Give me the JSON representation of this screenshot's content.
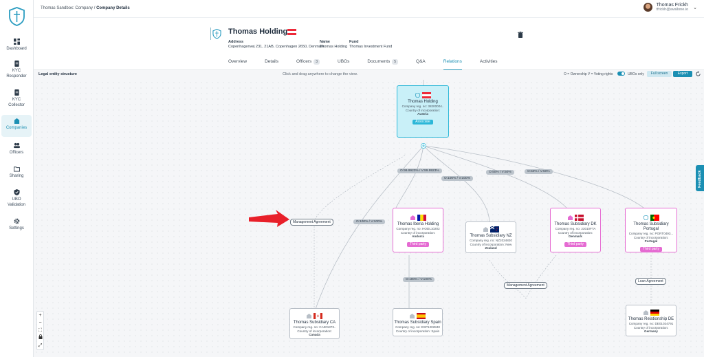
{
  "sidebar": {
    "items": [
      {
        "label": "Dashboard",
        "icon": "dashboard-icon"
      },
      {
        "label": "KYC Responder",
        "icon": "document-icon"
      },
      {
        "label": "KYC Collector",
        "icon": "document-icon"
      },
      {
        "label": "Companies",
        "icon": "buildings-icon"
      },
      {
        "label": "Officers",
        "icon": "people-icon"
      },
      {
        "label": "Sharing",
        "icon": "folder-icon"
      },
      {
        "label": "UBO Validation",
        "icon": "shield-check-icon"
      },
      {
        "label": "Settings",
        "icon": "gear-icon"
      }
    ],
    "active": "Companies"
  },
  "breadcrumb": {
    "root": "Thomas Sandbox:",
    "parent": "Company",
    "sep": "/",
    "current": "Company Details"
  },
  "user": {
    "name": "Thomas Frickh",
    "email": "tfrickh@avallone.io"
  },
  "company": {
    "name": "Thomas Holding",
    "address_label": "Address",
    "address": "Copenhagenvej 231, 21AB, Copenhagen 2650, Denmark",
    "name_label": "Name",
    "name_value": "Thomas Holding",
    "fund_label": "Fund",
    "fund_value": "Thomas Investment Fund"
  },
  "tabs": [
    {
      "label": "Overview",
      "badge": ""
    },
    {
      "label": "Details",
      "badge": ""
    },
    {
      "label": "Officers",
      "badge": "3"
    },
    {
      "label": "UBOs",
      "badge": ""
    },
    {
      "label": "Documents",
      "badge": "5"
    },
    {
      "label": "Q&A",
      "badge": ""
    },
    {
      "label": "Relations",
      "badge": ""
    },
    {
      "label": "Activities",
      "badge": ""
    }
  ],
  "toolbar": {
    "title": "Legal entity structure",
    "hint": "Click and drag anywhere to change the view.",
    "legend": "O = Ownership   V = Voting rights",
    "ubo_only": "UBOs only",
    "full_screen": "Full screen",
    "export": "Export"
  },
  "nodes": {
    "root": {
      "name": "Thomas Holding",
      "reg": "Company reg. no: 38200004..",
      "country_label": "Country of incorporation:",
      "country": "Austria",
      "tag": "Associate"
    },
    "iberia": {
      "name": "Thomas Iberia Holding",
      "reg": "Company reg. no: HODL10202",
      "country_label": "Country of incorporation:",
      "country": "Andorra",
      "tag": "Third party"
    },
    "nz": {
      "name": "Thomas Subsidiary NZ",
      "reg": "Company reg. no: NZ2024820",
      "country_label": "Country of incorporation: New",
      "country": "Zealand"
    },
    "dk": {
      "name": "Thomas Subsidiary DK",
      "reg": "Company reg. no: 23010FTA",
      "country_label": "Country of incorporation:",
      "country": "Denmark",
      "tag": "Third party"
    },
    "pt": {
      "name": "Thomas Subsidiary Portugal",
      "reg": "Company reg. no: PORT0493...",
      "country_label": "Country of incorporation:",
      "country": "Portugal",
      "tag": "Third party"
    },
    "ca": {
      "name": "Thomas Subsidiary CA",
      "reg": "Company reg. no: CA301373..",
      "country_label": "Country of incorporation:",
      "country": "Canada"
    },
    "es": {
      "name": "Thomas Subsidiary Spain",
      "reg": "Company reg. no: ESP1202840",
      "country_label": "Country of incorporation: Spain",
      "country": ""
    },
    "de": {
      "name": "Thomas Relationship DE",
      "reg": "Company reg. no: DE01024791",
      "country_label": "Country of incorporation:",
      "country": "Germany"
    }
  },
  "edges": {
    "iberia": "O:99.9923% / V:99.9923%",
    "nz": "O:100% / V:100%",
    "dk": "O:50% / V:50%",
    "pt": "O:50% / V:50%",
    "ca": "O:100% / V:100%",
    "es": "O:100% / V:100%"
  },
  "relations": {
    "mgmt1": "Management Agreement",
    "mgmt2": "Management Agreement",
    "loan": "Loan Agreement"
  },
  "zoom": [
    "+",
    "−",
    "⛶",
    "🔒",
    "⤢"
  ],
  "feedback": "Feedback",
  "colors": {
    "accent": "#1b8fb3",
    "third_party": "#e56bd2",
    "associate": "#2cb7d8",
    "arrow": "#e8202a"
  }
}
